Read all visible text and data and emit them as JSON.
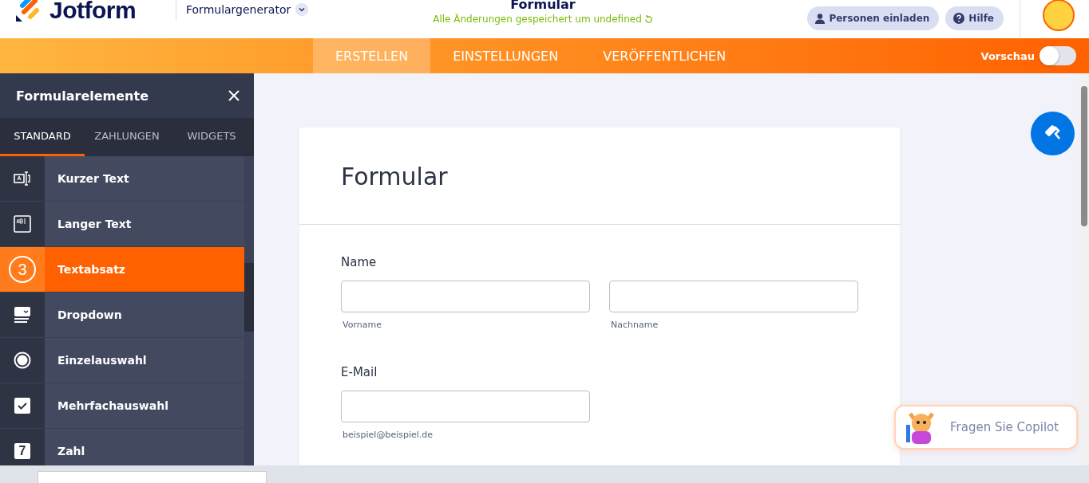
{
  "header": {
    "brand": "Jotform",
    "app_menu": "Formulargenerator",
    "form_title": "Formular",
    "save_status": "Alle Änderungen gespeichert um undefined",
    "buttons": [
      {
        "label": "Personen einladen",
        "kind": "invite"
      },
      {
        "label": "Hilfe",
        "kind": "help"
      }
    ]
  },
  "nav": {
    "tabs": [
      {
        "label": "ERSTELLEN",
        "selected": true
      },
      {
        "label": "EINSTELLUNGEN",
        "selected": false
      },
      {
        "label": "VERÖFFENTLICHEN",
        "selected": false
      }
    ],
    "preview": {
      "label": "Vorschau",
      "on": false
    }
  },
  "sidebar": {
    "title": "Formularelemente",
    "tabs": [
      {
        "label": "STANDARD",
        "selected": true
      },
      {
        "label": "ZAHLUNGEN",
        "selected": false
      },
      {
        "label": "WIDGETS",
        "selected": false
      }
    ],
    "items": [
      {
        "label": "Kurzer Text",
        "kind": "short",
        "selected": false
      },
      {
        "label": "Langer Text",
        "kind": "long",
        "selected": false
      },
      {
        "label": "Textabsatz",
        "kind": "paragraph",
        "selected": true,
        "badge": "3"
      },
      {
        "label": "Dropdown",
        "kind": "dropdown",
        "selected": false
      },
      {
        "label": "Einzelauswahl",
        "kind": "radio",
        "selected": false
      },
      {
        "label": "Mehrfachauswahl",
        "kind": "checkbox",
        "selected": false
      },
      {
        "label": "Zahl",
        "kind": "number",
        "selected": false,
        "glyph": "7"
      }
    ]
  },
  "form": {
    "title": "Formular",
    "fields": [
      {
        "label": "Name",
        "inputs": [
          {
            "sublabel": "Vorname"
          },
          {
            "sublabel": "Nachname"
          }
        ]
      },
      {
        "label": "E-Mail",
        "inputs": [
          {
            "sublabel": "beispiel@beispiel.de"
          }
        ]
      }
    ]
  },
  "copilot": {
    "label": "Fragen Sie Copilot"
  }
}
